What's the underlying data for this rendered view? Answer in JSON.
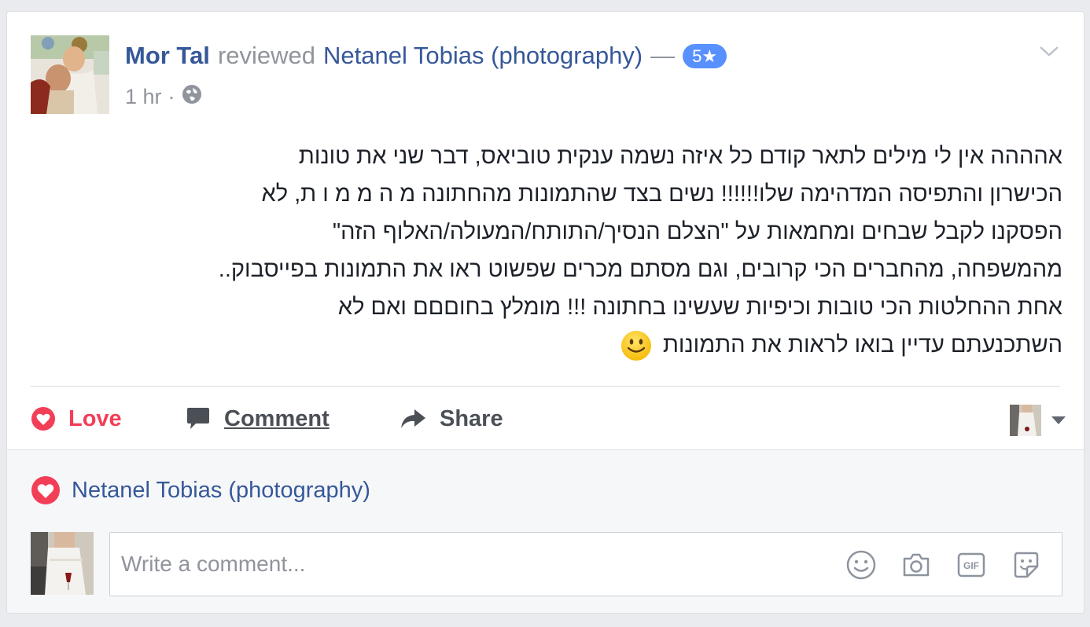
{
  "post": {
    "author": "Mor Tal",
    "verb": "reviewed",
    "page": "Netanel Tobias (photography)",
    "dash": "—",
    "rating": "5★",
    "time": "1 hr",
    "time_separator": "·",
    "text_lines": [
      "אהההה אין לי מילים לתאר קודם כל איזה נשמה ענקית טוביאס, דבר שני את טונות",
      "הכישרון והתפיסה המדהימה שלו!!!!!! נשים בצד שהתמונות מהחתונה מ ה מ מ ו ת, לא",
      "הפסקנו לקבל שבחים ומחמאות על \"הצלם הנסיך/התותח/המעולה/האלוף הזה\"",
      "מהמשפחה, מהחברים הכי קרובים, וגם מסתם מכרים שפשוט ראו את התמונות בפייסבוק..",
      "אחת ההחלטות הכי טובות וכיפיות שעשינו בחתונה !!! מומלץ בחוםםם ואם לא",
      "השתכנעתם עדיין בואו לראות את התמונות"
    ]
  },
  "actions": {
    "love": "Love",
    "comment": "Comment",
    "share": "Share"
  },
  "reactions": {
    "name": "Netanel Tobias (photography)"
  },
  "comment_box": {
    "placeholder": "Write a comment..."
  },
  "icons": {
    "globe": "globe-icon",
    "chevron": "chevron-down-icon",
    "heart": "heart-icon",
    "comment": "comment-icon",
    "share": "share-icon",
    "emoji": "emoji-icon",
    "camera": "camera-icon",
    "gif": "gif-icon",
    "sticker": "sticker-icon"
  },
  "colors": {
    "link": "#365899",
    "love": "#f33e58",
    "rating": "#5890ff",
    "muted": "#90949c"
  }
}
